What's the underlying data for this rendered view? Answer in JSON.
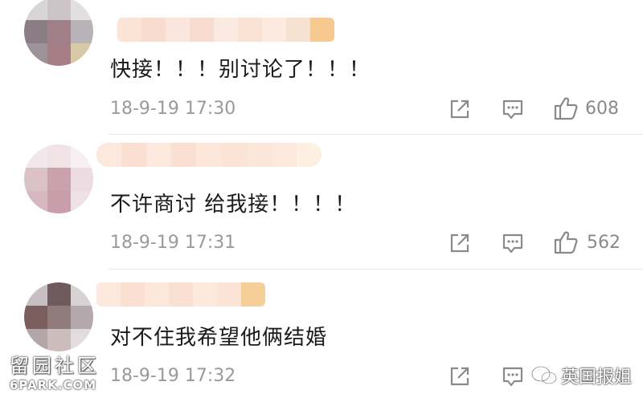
{
  "colors": {
    "background": "#ffffff",
    "text": "#1a1a1a",
    "meta": "#9a9a9a",
    "icon": "#8a8a8a",
    "divider": "#e8e8e8"
  },
  "comments": [
    {
      "text": "快接！！！别讨论了！！！",
      "timestamp": "18-9-19 17:30",
      "likes": "608",
      "icons": [
        "share-icon",
        "comment-icon",
        "thumbs-up-icon"
      ]
    },
    {
      "text": "不许商讨 给我接！！！！",
      "timestamp": "18-9-19 17:31",
      "likes": "562",
      "icons": [
        "share-icon",
        "comment-icon",
        "thumbs-up-icon"
      ]
    },
    {
      "text": "对不住我希望他俩结婚",
      "timestamp": "18-9-19 17:32",
      "likes": "",
      "icons": [
        "share-icon",
        "comment-icon"
      ]
    }
  ],
  "watermarks": {
    "left_cn": "留园社区",
    "left_en": "6PARK.COM",
    "right": "英国报姐",
    "right_icon": "wechat-icon"
  }
}
